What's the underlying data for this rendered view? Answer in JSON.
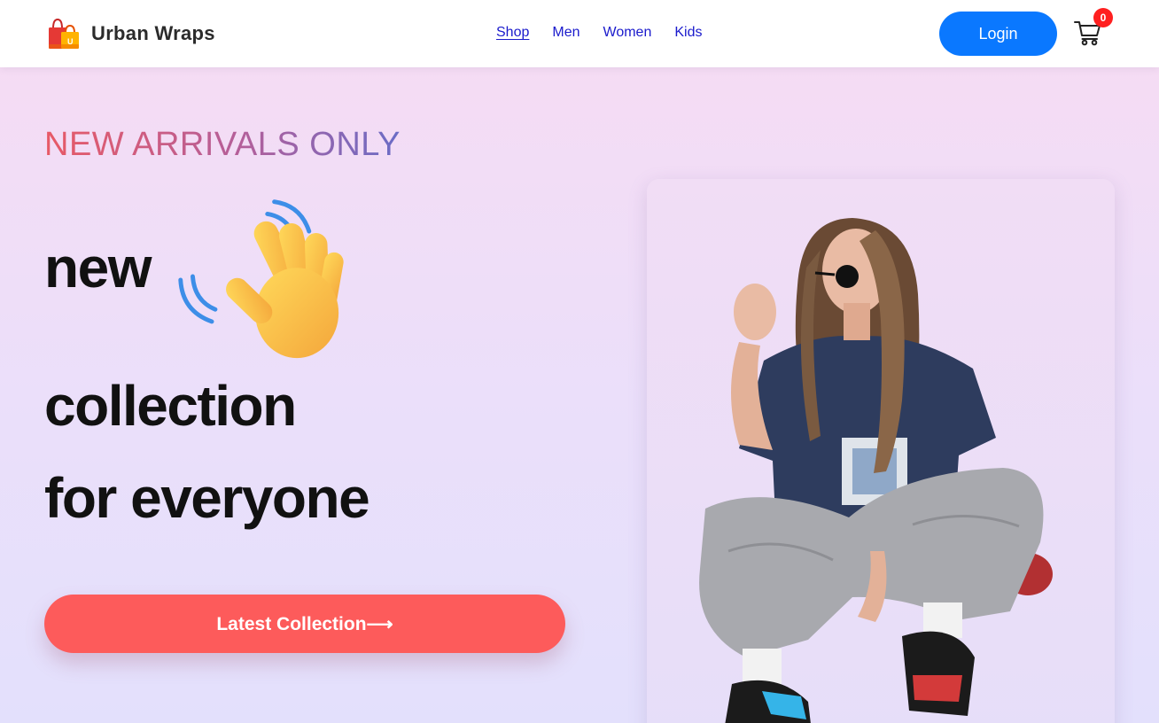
{
  "header": {
    "brand_name": "Urban Wraps",
    "nav": [
      {
        "label": "Shop",
        "active": true
      },
      {
        "label": "Men",
        "active": false
      },
      {
        "label": "Women",
        "active": false
      },
      {
        "label": "Kids",
        "active": false
      }
    ],
    "login_label": "Login",
    "cart_count": "0",
    "icons": {
      "logo": "shopping-bags-logo-icon",
      "cart": "cart-icon"
    }
  },
  "hero": {
    "tagline": "NEW ARRIVALS ONLY",
    "headline_line1": "new",
    "headline_line2": "collection",
    "headline_line3": "for everyone",
    "emoji": "waving-hand-icon",
    "cta_label": "Latest Collection⟶",
    "image": "model-crouching-photo"
  },
  "colors": {
    "link": "#1a1acc",
    "login_button": "#0a78ff",
    "cta_button": "#fd5b5b",
    "cart_badge": "#ff1f1f",
    "hero_bg_top": "#f5dcf4",
    "hero_bg_bottom": "#e3e0fc"
  }
}
